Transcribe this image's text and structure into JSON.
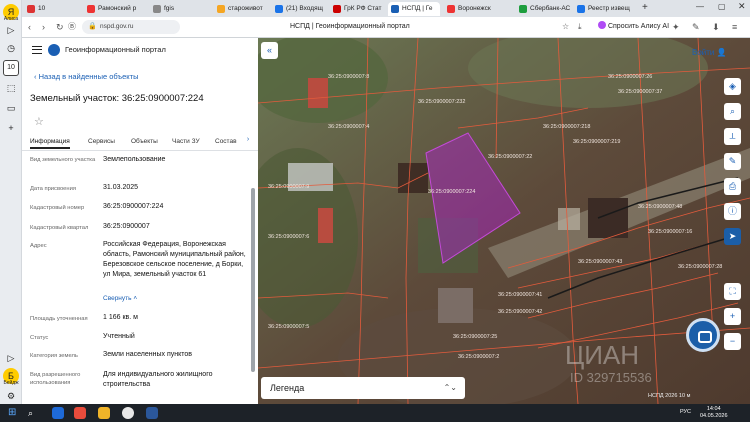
{
  "sidebar": {
    "labels": [
      "Алиса",
      "Бейдж"
    ]
  },
  "tabs": [
    {
      "title": "10",
      "color": "#d33"
    },
    {
      "title": "Рамонский р",
      "color": "#e33"
    },
    {
      "title": "fgis",
      "color": "#888"
    },
    {
      "title": "староживот",
      "color": "#f5a623"
    },
    {
      "title": "(21) Входящ",
      "color": "#1a73e8"
    },
    {
      "title": "ГрК РФ Стат",
      "color": "#c00"
    },
    {
      "title": "НСПД | Ге",
      "color": "#1a5fb4"
    },
    {
      "title": "Воронежск",
      "color": "#e33"
    },
    {
      "title": "Сбербанк-АС",
      "color": "#1e9e3e"
    },
    {
      "title": "Реестр извещ",
      "color": "#1a73e8"
    }
  ],
  "address_bar": {
    "url": "nspd.gov.ru",
    "page_title": "НСПД | Геоинформационный портал",
    "alice": "Спросить Алису AI"
  },
  "panel": {
    "portal_name": "Геоинформационный портал",
    "back_link": "Назад в найденные объекты",
    "title": "Земельный участок: 36:25:0900007:224",
    "tabs": [
      "Информация",
      "Сервисы",
      "Объекты",
      "Части ЗУ",
      "Состав"
    ],
    "fields": [
      {
        "label": "Вид земельного участка",
        "value": "Землепользование"
      },
      {
        "label": "Дата присвоения",
        "value": "31.03.2025"
      },
      {
        "label": "Кадастровый номер",
        "value": "36:25:0900007:224"
      },
      {
        "label": "Кадастровый квартал",
        "value": "36:25:0900007"
      },
      {
        "label": "Адрес",
        "value": "Российская Федерация, Воронежская область, Рамонский муниципальный район, Березовское сельское поселение, д Борки, ул Мира, земельный участок 61"
      },
      {
        "label": "Площадь уточненная",
        "value": "1 166 кв. м"
      },
      {
        "label": "Статус",
        "value": "Учтенный"
      },
      {
        "label": "Категория земель",
        "value": "Земли населенных пунктов"
      },
      {
        "label": "Вид разрешенного использования",
        "value": "Для индивидуального жилищного строительства"
      }
    ],
    "collapse_label": "Свернуть"
  },
  "map": {
    "login_label": "Войти",
    "legend_label": "Легенда",
    "watermark": "ЦИАН",
    "watermark_id": "ID 329715536",
    "attribution": "НСПД 2026",
    "scale": "10 м",
    "parcel_labels": [
      "36:25:0900007:8",
      "36:25:0900007:4",
      "36:25:0900007:232",
      "36:25:0900007:37",
      "36:25:0900007:219",
      "36:25:0900007:218",
      "36:25:0900007:22",
      "36:25:0900007:26",
      "36:25:0900007:224",
      "36:25:0900007:48",
      "36:25:0900007:16",
      "36:25:0900007:43",
      "36:25:0900007:28",
      "36:25:0900007:41",
      "36:25:0900007:42",
      "36:25:0900007:2",
      "36:25:0900007:25",
      "36:25:0900007:9",
      "36:25:0900007:6",
      "36:25:0900007:5"
    ]
  },
  "taskbar": {
    "lang": "РУС",
    "time": "14:04",
    "date": "04.05.2026"
  }
}
